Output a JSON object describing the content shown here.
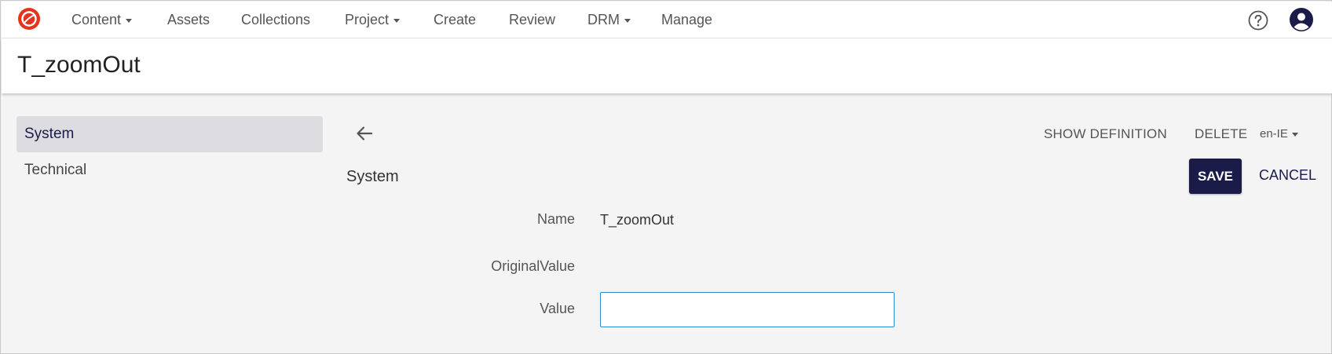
{
  "nav": {
    "logo_icon": "red-ring-logo",
    "items": [
      {
        "label": "Content",
        "dropdown": true
      },
      {
        "label": "Assets",
        "dropdown": false
      },
      {
        "label": "Collections",
        "dropdown": false
      },
      {
        "label": "Project",
        "dropdown": true
      },
      {
        "label": "Create",
        "dropdown": false
      },
      {
        "label": "Review",
        "dropdown": false
      },
      {
        "label": "DRM",
        "dropdown": true
      },
      {
        "label": "Manage",
        "dropdown": false
      }
    ],
    "help_icon": "help-circle-icon",
    "avatar_icon": "user-avatar-icon"
  },
  "page": {
    "title": "T_zoomOut"
  },
  "sidebar": {
    "items": [
      {
        "label": "System",
        "active": true
      },
      {
        "label": "Technical",
        "active": false
      }
    ]
  },
  "toolbar": {
    "show_definition": "SHOW DEFINITION",
    "delete": "DELETE",
    "locale": "en-IE",
    "save": "SAVE",
    "cancel": "CANCEL"
  },
  "section": {
    "title": "System"
  },
  "fields": {
    "name_label": "Name",
    "name_value": "T_zoomOut",
    "original_label": "OriginalValue",
    "original_value": "",
    "value_label": "Value",
    "value_value": ""
  },
  "colors": {
    "brand_red": "#e8331c",
    "primary_navy": "#1b1b4a",
    "focus_blue": "#2a8bd6",
    "sidebar_active_bg": "#dcdce1"
  }
}
